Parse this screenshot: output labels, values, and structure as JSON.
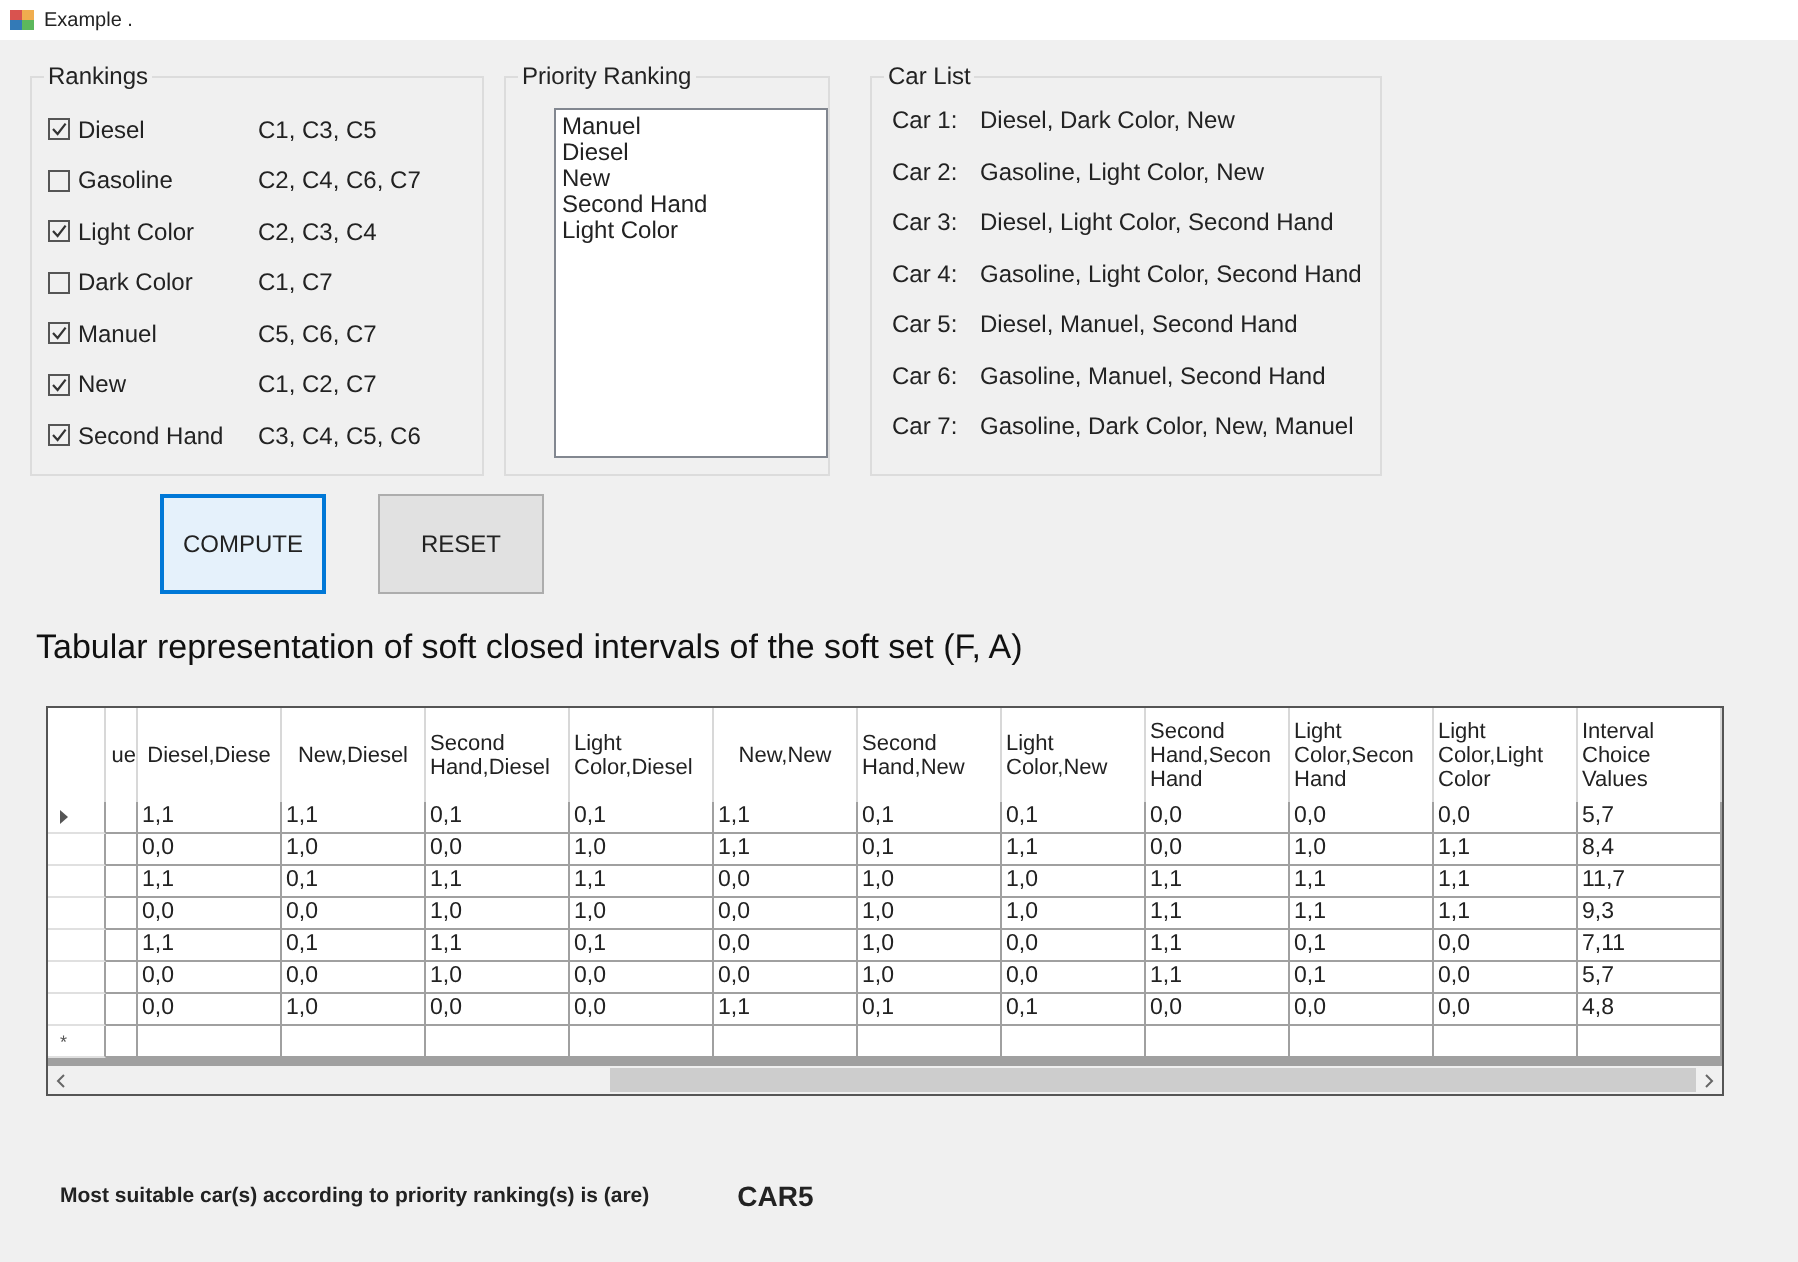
{
  "window": {
    "title": "Example ."
  },
  "rankings": {
    "title": "Rankings",
    "items": [
      {
        "label": "Diesel",
        "checked": true,
        "cars": "C1, C3, C5"
      },
      {
        "label": "Gasoline",
        "checked": false,
        "cars": "C2, C4, C6, C7"
      },
      {
        "label": "Light Color",
        "checked": true,
        "cars": "C2, C3, C4"
      },
      {
        "label": "Dark Color",
        "checked": false,
        "cars": "C1, C7"
      },
      {
        "label": "Manuel",
        "checked": true,
        "cars": "C5, C6, C7"
      },
      {
        "label": "New",
        "checked": true,
        "cars": "C1, C2, C7"
      },
      {
        "label": "Second Hand",
        "checked": true,
        "cars": "C3, C4, C5, C6"
      }
    ]
  },
  "priority_ranking": {
    "title": "Priority Ranking",
    "items": [
      "Manuel",
      "Diesel",
      "New",
      "Second Hand",
      "Light Color"
    ]
  },
  "car_list": {
    "title": "Car List",
    "items": [
      {
        "label": "Car 1:",
        "features": "Diesel, Dark Color, New"
      },
      {
        "label": "Car 2:",
        "features": "Gasoline, Light Color, New"
      },
      {
        "label": "Car 3:",
        "features": "Diesel, Light Color, Second Hand"
      },
      {
        "label": "Car 4:",
        "features": "Gasoline, Light Color, Second Hand"
      },
      {
        "label": "Car 5:",
        "features": "Diesel, Manuel, Second Hand"
      },
      {
        "label": "Car 6:",
        "features": "Gasoline, Manuel, Second Hand"
      },
      {
        "label": "Car 7:",
        "features": "Gasoline, Dark Color, New, Manuel"
      }
    ]
  },
  "buttons": [
    {
      "label": "COMPUTE",
      "focused": true
    },
    {
      "label": "RESET",
      "focused": false
    }
  ],
  "heading": "Tabular representation of soft closed intervals of the soft set (F, A)",
  "table": {
    "columns": [
      "ue",
      "Diesel,Diese",
      "New,Diesel",
      "Second Hand,Diesel",
      "Light Color,Diesel",
      "New,New",
      "Second Hand,New",
      "Light Color,New",
      "Second Hand,Secon Hand",
      "Light Color,Secon Hand",
      "Light Color,Light Color",
      "Interval Choice Values"
    ],
    "rows": [
      {
        "current": true,
        "cells": [
          "",
          "1,1",
          "1,1",
          "0,1",
          "0,1",
          "1,1",
          "0,1",
          "0,1",
          "0,0",
          "0,0",
          "0,0",
          "5,7"
        ]
      },
      {
        "current": false,
        "cells": [
          "",
          "0,0",
          "1,0",
          "0,0",
          "1,0",
          "1,1",
          "0,1",
          "1,1",
          "0,0",
          "1,0",
          "1,1",
          "8,4"
        ]
      },
      {
        "current": false,
        "cells": [
          "",
          "1,1",
          "0,1",
          "1,1",
          "1,1",
          "0,0",
          "1,0",
          "1,0",
          "1,1",
          "1,1",
          "1,1",
          "11,7"
        ]
      },
      {
        "current": false,
        "cells": [
          "",
          "0,0",
          "0,0",
          "1,0",
          "1,0",
          "0,0",
          "1,0",
          "1,0",
          "1,1",
          "1,1",
          "1,1",
          "9,3"
        ]
      },
      {
        "current": false,
        "cells": [
          "",
          "1,1",
          "0,1",
          "1,1",
          "0,1",
          "0,0",
          "1,0",
          "0,0",
          "1,1",
          "0,1",
          "0,0",
          "7,11"
        ]
      },
      {
        "current": false,
        "cells": [
          "",
          "0,0",
          "0,0",
          "1,0",
          "0,0",
          "0,0",
          "1,0",
          "0,0",
          "1,1",
          "0,1",
          "0,0",
          "5,7"
        ]
      },
      {
        "current": false,
        "cells": [
          "",
          "0,0",
          "1,0",
          "0,0",
          "0,0",
          "1,1",
          "0,1",
          "0,1",
          "0,0",
          "0,0",
          "0,0",
          "4,8"
        ]
      }
    ],
    "new_row_marker": "*"
  },
  "result": {
    "label": "Most suitable car(s) according to priority ranking(s) is (are)",
    "value": "CAR5"
  }
}
